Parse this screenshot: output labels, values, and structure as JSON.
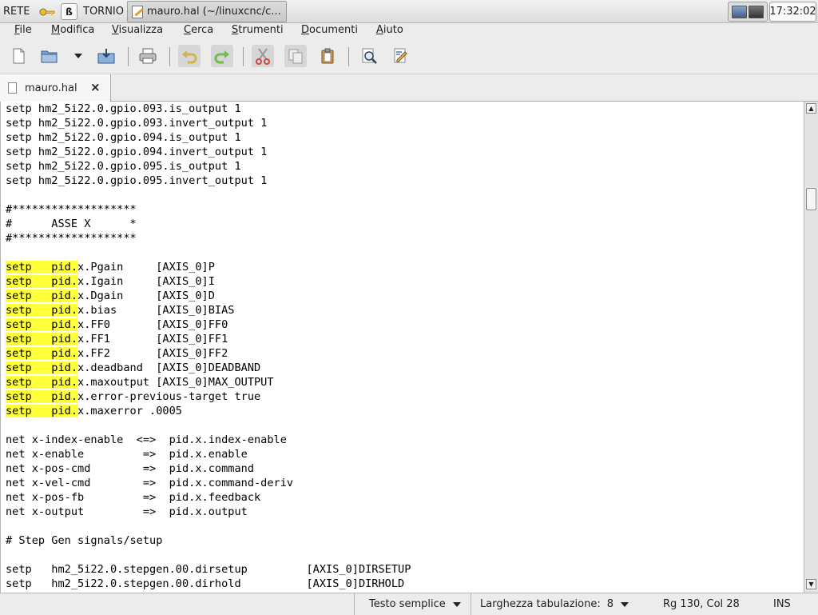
{
  "taskbar": {
    "network_label": "RETE",
    "torn_button": "ß",
    "tornio_label": "TORNIO",
    "task_title": "mauro.hal (~/linuxcnc/c...",
    "clock": "17:32:02",
    "tray_icons": [
      "network-icon",
      "monitor-icon"
    ]
  },
  "menubar": {
    "items": [
      {
        "pre": "",
        "u": "F",
        "post": "ile"
      },
      {
        "pre": "",
        "u": "M",
        "post": "odifica"
      },
      {
        "pre": "",
        "u": "V",
        "post": "isualizza"
      },
      {
        "pre": "",
        "u": "C",
        "post": "erca"
      },
      {
        "pre": "",
        "u": "S",
        "post": "trumenti"
      },
      {
        "pre": "",
        "u": "D",
        "post": "ocumenti"
      },
      {
        "pre": "",
        "u": "A",
        "post": "iuto"
      }
    ]
  },
  "toolbar": {
    "buttons": [
      "new-document-icon",
      "open-icon",
      "open-dropdown-icon",
      "save-icon",
      "print-icon",
      "undo-icon",
      "redo-icon",
      "cut-icon",
      "copy-icon",
      "paste-icon",
      "find-icon",
      "find-replace-icon"
    ]
  },
  "tab": {
    "label": "mauro.hal",
    "close": "×"
  },
  "editor": {
    "lines": [
      {
        "hl": "",
        "rest": "setp hm2_5i22.0.gpio.093.is_output 1"
      },
      {
        "hl": "",
        "rest": "setp hm2_5i22.0.gpio.093.invert_output 1"
      },
      {
        "hl": "",
        "rest": "setp hm2_5i22.0.gpio.094.is_output 1"
      },
      {
        "hl": "",
        "rest": "setp hm2_5i22.0.gpio.094.invert_output 1"
      },
      {
        "hl": "",
        "rest": "setp hm2_5i22.0.gpio.095.is_output 1"
      },
      {
        "hl": "",
        "rest": "setp hm2_5i22.0.gpio.095.invert_output 1"
      },
      {
        "hl": "",
        "rest": ""
      },
      {
        "hl": "",
        "rest": "#*******************"
      },
      {
        "hl": "",
        "rest": "#      ASSE X      *"
      },
      {
        "hl": "",
        "rest": "#*******************"
      },
      {
        "hl": "",
        "rest": ""
      },
      {
        "hl": "setp   pid.",
        "rest": "x.Pgain     [AXIS_0]P"
      },
      {
        "hl": "setp   pid.",
        "rest": "x.Igain     [AXIS_0]I"
      },
      {
        "hl": "setp   pid.",
        "rest": "x.Dgain     [AXIS_0]D"
      },
      {
        "hl": "setp   pid.",
        "rest": "x.bias      [AXIS_0]BIAS"
      },
      {
        "hl": "setp   pid.",
        "rest": "x.FF0       [AXIS_0]FF0"
      },
      {
        "hl": "setp   pid.",
        "rest": "x.FF1       [AXIS_0]FF1"
      },
      {
        "hl": "setp   pid.",
        "rest": "x.FF2       [AXIS_0]FF2"
      },
      {
        "hl": "setp   pid.",
        "rest": "x.deadband  [AXIS_0]DEADBAND"
      },
      {
        "hl": "setp   pid.",
        "rest": "x.maxoutput [AXIS_0]MAX_OUTPUT"
      },
      {
        "hl": "setp   pid.",
        "rest": "x.error-previous-target true"
      },
      {
        "hl": "setp   pid.",
        "rest": "x.maxerror .0005"
      },
      {
        "hl": "",
        "rest": ""
      },
      {
        "hl": "",
        "rest": "net x-index-enable  <=>  pid.x.index-enable"
      },
      {
        "hl": "",
        "rest": "net x-enable         =>  pid.x.enable"
      },
      {
        "hl": "",
        "rest": "net x-pos-cmd        =>  pid.x.command"
      },
      {
        "hl": "",
        "rest": "net x-vel-cmd        =>  pid.x.command-deriv"
      },
      {
        "hl": "",
        "rest": "net x-pos-fb         =>  pid.x.feedback"
      },
      {
        "hl": "",
        "rest": "net x-output         =>  pid.x.output"
      },
      {
        "hl": "",
        "rest": ""
      },
      {
        "hl": "",
        "rest": "# Step Gen signals/setup"
      },
      {
        "hl": "",
        "rest": ""
      },
      {
        "hl": "",
        "rest": "setp   hm2_5i22.0.stepgen.00.dirsetup         [AXIS_0]DIRSETUP"
      },
      {
        "hl": "",
        "rest": "setp   hm2_5i22.0.stepgen.00.dirhold          [AXIS_0]DIRHOLD"
      }
    ],
    "highlight_color": "#ffff3a"
  },
  "statusbar": {
    "language": "Testo semplice",
    "tab_width_label": "Larghezza tabulazione:",
    "tab_width_value": "8",
    "position": "Rg 130, Col 28",
    "mode": "INS"
  }
}
